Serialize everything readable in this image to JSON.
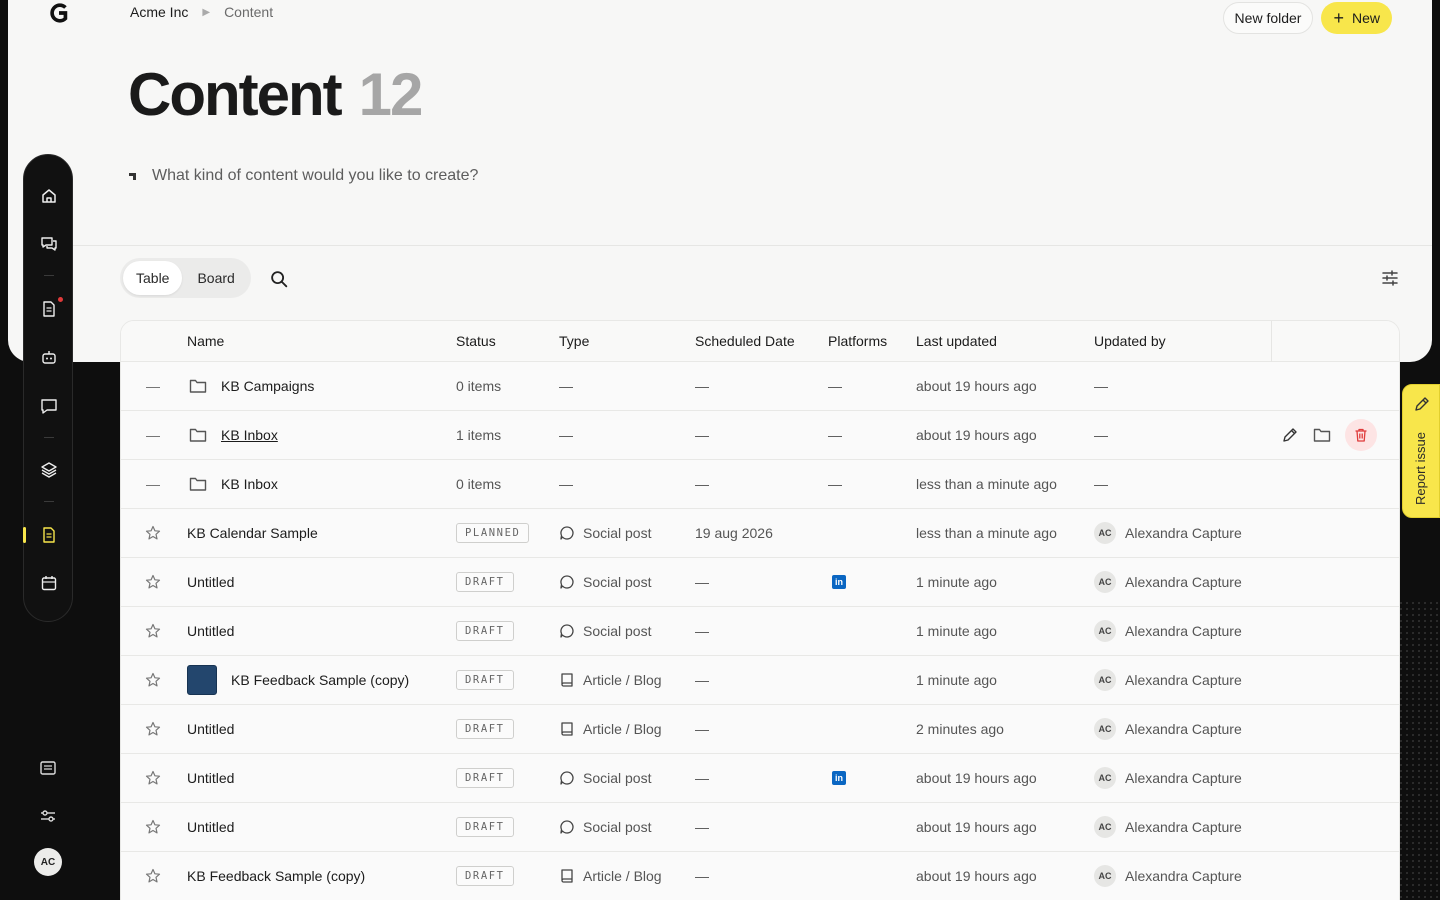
{
  "header": {
    "breadcrumb": [
      "Acme Inc",
      "Content"
    ],
    "new_folder_label": "New folder",
    "new_label": "New"
  },
  "page": {
    "title": "Content",
    "count": "12",
    "prompt_placeholder": "What kind of content would you like to create?"
  },
  "toolbar": {
    "views": [
      "Table",
      "Board"
    ],
    "active_view": "Table"
  },
  "table": {
    "columns": [
      "Name",
      "Status",
      "Type",
      "Scheduled Date",
      "Platforms",
      "Last updated",
      "Updated by"
    ],
    "rows": [
      {
        "kind": "folder",
        "lead": "—",
        "name": "KB Campaigns",
        "status": "0 items",
        "type": "—",
        "date": "—",
        "platforms": "—",
        "updated": "about 19 hours ago",
        "by": "—"
      },
      {
        "kind": "folder",
        "lead": "—",
        "name": "KB Inbox",
        "status": "1 items",
        "type": "—",
        "date": "—",
        "platforms": "—",
        "updated": "about 19 hours ago",
        "by": "—",
        "hovered": true
      },
      {
        "kind": "folder",
        "lead": "—",
        "name": "KB Inbox",
        "status": "0 items",
        "type": "—",
        "date": "—",
        "platforms": "—",
        "updated": "less than a minute ago",
        "by": "—"
      },
      {
        "kind": "item",
        "name": "KB Calendar Sample",
        "status": "PLANNED",
        "type": "Social post",
        "type_icon": "chat-bubble-icon",
        "date": "19 aug 2026",
        "platforms": "",
        "updated": "less than a minute ago",
        "by_initials": "AC",
        "by": "Alexandra Capture"
      },
      {
        "kind": "item",
        "name": "Untitled",
        "status": "DRAFT",
        "type": "Social post",
        "type_icon": "chat-bubble-icon",
        "date": "—",
        "platforms": "linkedin",
        "updated": "1 minute ago",
        "by_initials": "AC",
        "by": "Alexandra Capture"
      },
      {
        "kind": "item",
        "name": "Untitled",
        "status": "DRAFT",
        "type": "Social post",
        "type_icon": "chat-bubble-icon",
        "date": "—",
        "platforms": "",
        "updated": "1 minute ago",
        "by_initials": "AC",
        "by": "Alexandra Capture"
      },
      {
        "kind": "item",
        "name": "KB Feedback Sample (copy)",
        "thumb": true,
        "status": "DRAFT",
        "type": "Article / Blog",
        "type_icon": "book-icon",
        "date": "—",
        "platforms": "",
        "updated": "1 minute ago",
        "by_initials": "AC",
        "by": "Alexandra Capture"
      },
      {
        "kind": "item",
        "name": "Untitled",
        "status": "DRAFT",
        "type": "Article / Blog",
        "type_icon": "book-icon",
        "date": "—",
        "platforms": "",
        "updated": "2 minutes ago",
        "by_initials": "AC",
        "by": "Alexandra Capture"
      },
      {
        "kind": "item",
        "name": "Untitled",
        "status": "DRAFT",
        "type": "Social post",
        "type_icon": "chat-bubble-icon",
        "date": "—",
        "platforms": "linkedin",
        "updated": "about 19 hours ago",
        "by_initials": "AC",
        "by": "Alexandra Capture"
      },
      {
        "kind": "item",
        "name": "Untitled",
        "status": "DRAFT",
        "type": "Social post",
        "type_icon": "chat-bubble-icon",
        "date": "—",
        "platforms": "",
        "updated": "about 19 hours ago",
        "by_initials": "AC",
        "by": "Alexandra Capture"
      },
      {
        "kind": "item",
        "name": "KB Feedback Sample (copy)",
        "status": "DRAFT",
        "type": "Article / Blog",
        "type_icon": "book-icon",
        "date": "—",
        "platforms": "",
        "updated": "about 19 hours ago",
        "by_initials": "AC",
        "by": "Alexandra Capture"
      }
    ]
  },
  "sidebar": {
    "items": [
      "home-icon",
      "chats-icon",
      "document-icon",
      "robot-icon",
      "message-icon",
      "layers-icon",
      "content-icon",
      "calendar-icon"
    ],
    "active": "content-icon",
    "user_initials": "AC"
  },
  "report": {
    "label": "Report issue"
  },
  "colors": {
    "accent": "#f8e64b",
    "danger": "#e03a3a",
    "linkedin": "#0a66c2"
  }
}
